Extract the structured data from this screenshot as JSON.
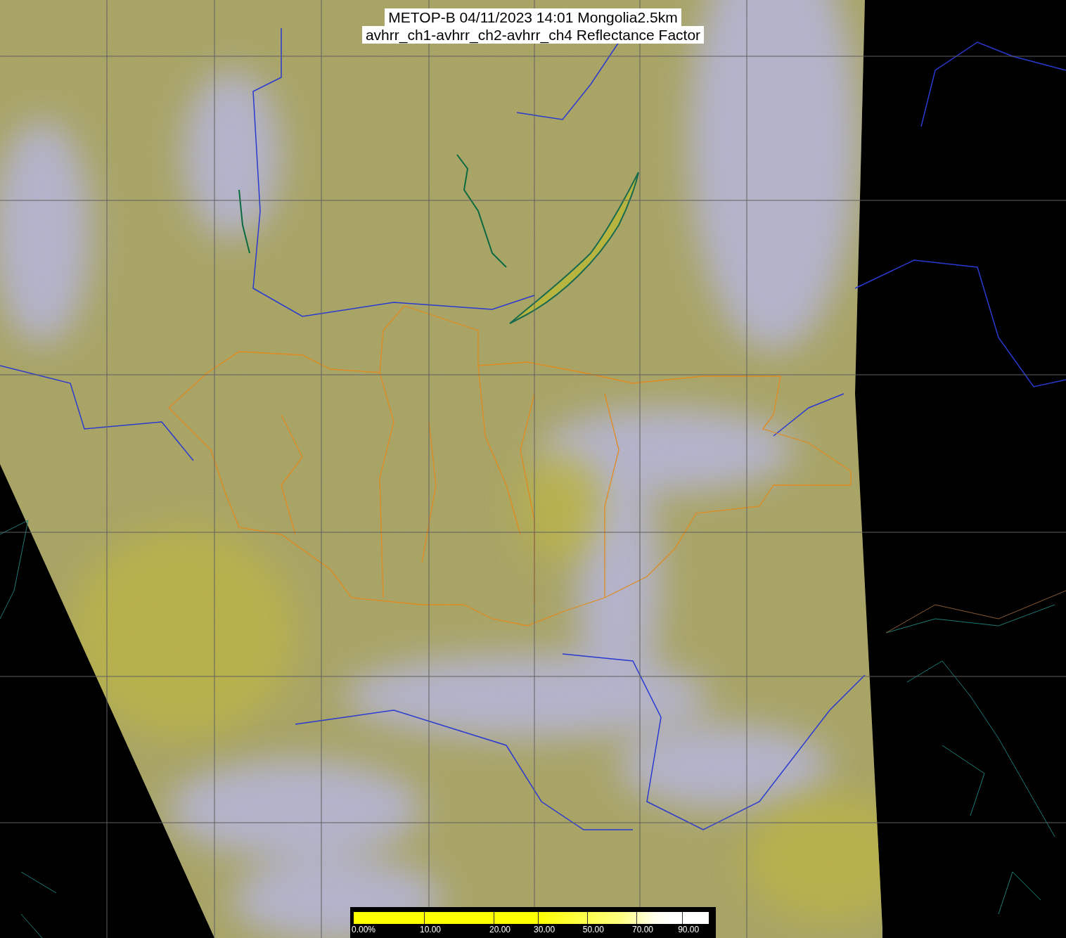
{
  "title": {
    "lines": [
      "METOP-B 04/11/2023 14:01 Mongolia2.5km",
      "avhrr_ch1-avhrr_ch2-avhrr_ch4 Reflectance Factor"
    ]
  },
  "colorbar": {
    "labels": [
      "0.00%",
      "10.00",
      "20.00",
      "30.00",
      "50.00",
      "70.00",
      "90.00"
    ]
  }
}
